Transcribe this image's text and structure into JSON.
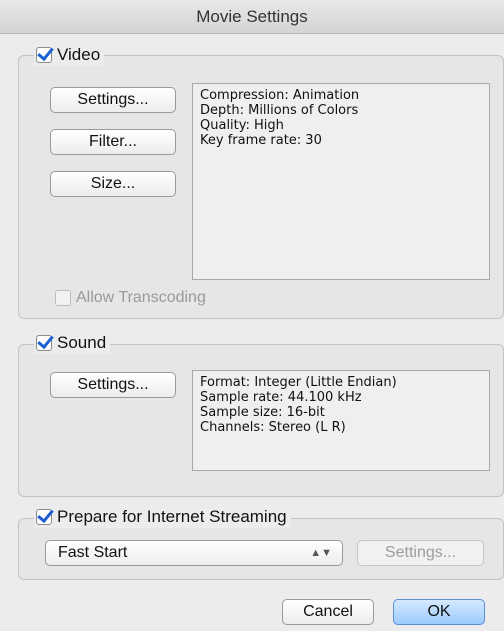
{
  "window": {
    "title": "Movie Settings"
  },
  "video": {
    "label": "Video",
    "checked": true,
    "buttons": {
      "settings": "Settings...",
      "filter": "Filter...",
      "size": "Size..."
    },
    "info": [
      "Compression: Animation",
      "Depth: Millions of Colors",
      "Quality: High",
      "Key frame rate: 30"
    ],
    "allow_transcoding": {
      "label": "Allow Transcoding",
      "checked": false,
      "enabled": false
    }
  },
  "sound": {
    "label": "Sound",
    "checked": true,
    "buttons": {
      "settings": "Settings..."
    },
    "info": [
      "Format: Integer (Little Endian)",
      "Sample rate: 44.100 kHz",
      "Sample size: 16-bit",
      "Channels: Stereo (L R)"
    ]
  },
  "streaming": {
    "label": "Prepare for Internet Streaming",
    "checked": true,
    "select_value": "Fast Start",
    "settings_button": "Settings...",
    "settings_enabled": false
  },
  "footer": {
    "cancel": "Cancel",
    "ok": "OK"
  }
}
